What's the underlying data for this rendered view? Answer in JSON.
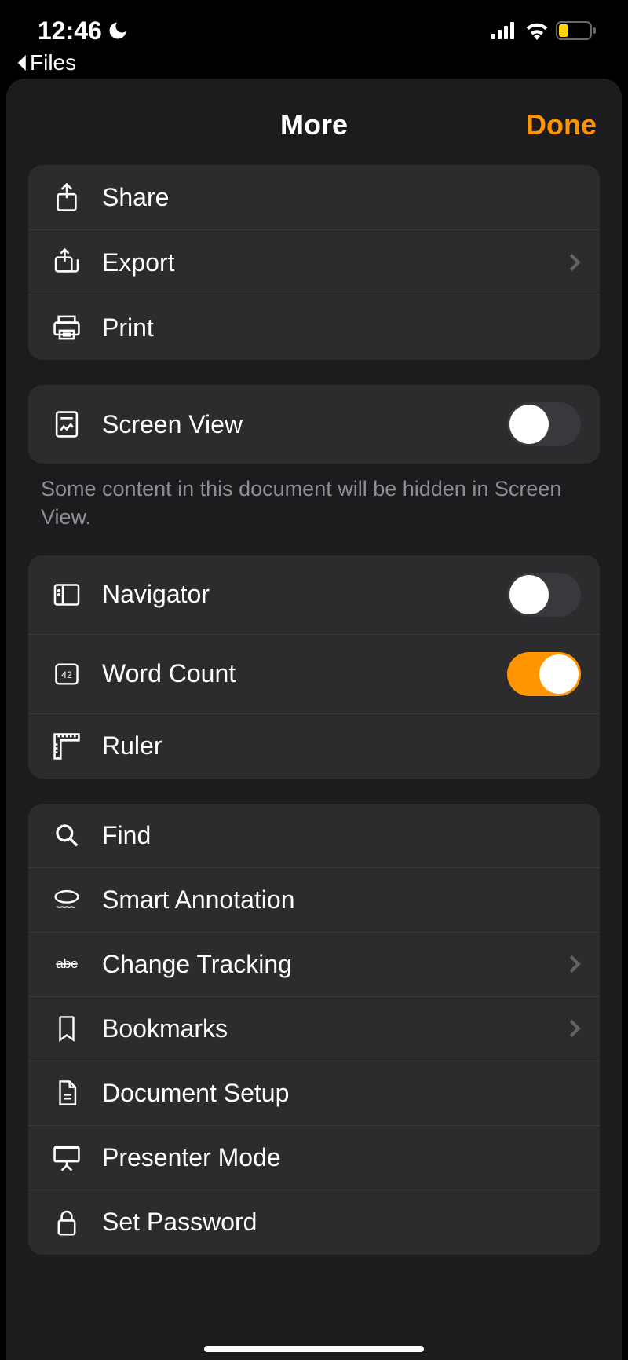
{
  "statusBar": {
    "time": "12:46",
    "backLabel": "Files"
  },
  "sheet": {
    "title": "More",
    "done": "Done"
  },
  "group1": {
    "share": "Share",
    "export": "Export",
    "print": "Print"
  },
  "group2": {
    "screenView": "Screen View",
    "screenViewOn": false,
    "desc": "Some content in this document will be hidden in Screen View."
  },
  "group3": {
    "navigator": "Navigator",
    "navigatorOn": false,
    "wordCount": "Word Count",
    "wordCountOn": true,
    "ruler": "Ruler"
  },
  "group4": {
    "find": "Find",
    "smartAnnotation": "Smart Annotation",
    "changeTracking": "Change Tracking",
    "bookmarks": "Bookmarks",
    "documentSetup": "Document Setup",
    "presenterMode": "Presenter Mode",
    "setPassword": "Set Password"
  }
}
